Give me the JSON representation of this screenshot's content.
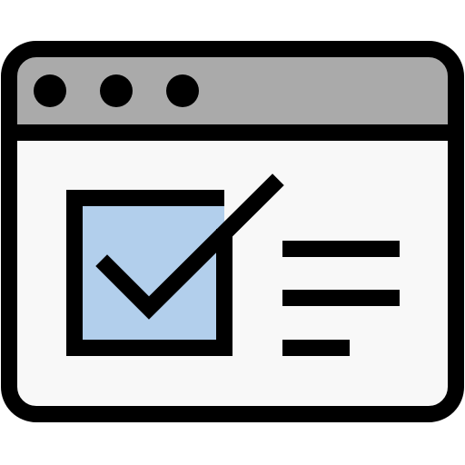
{
  "icon": {
    "name": "browser-window-checklist-icon",
    "colors": {
      "stroke": "#000000",
      "titlebar": "#aaaaaa",
      "content": "#f8f8f8",
      "checkbox_fill": "#b2cfec",
      "dots": "#000000"
    },
    "window_controls": [
      "dot",
      "dot",
      "dot"
    ],
    "checkbox_checked": true,
    "text_lines": 3
  }
}
